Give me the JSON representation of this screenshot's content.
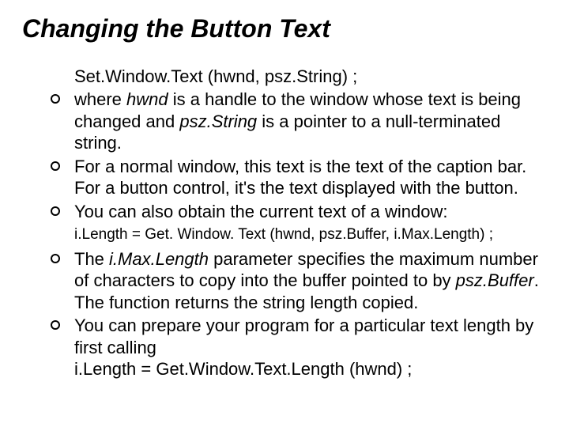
{
  "title": "Changing the Button Text",
  "codeLine": "Set.Window.Text (hwnd, psz.String) ;",
  "bullets": {
    "b1_pre": "where ",
    "b1_hwnd": "hwnd",
    "b1_mid": " is a handle to the window whose text is being changed and ",
    "b1_psz": "psz.String",
    "b1_post": " is a pointer to a null-terminated string.",
    "b2": "For a normal window, this text is the text of the caption bar. For a button control, it's the text displayed with the button.",
    "b3": "You can also obtain the current text of a window:",
    "subCode": "i.Length = Get. Window. Text (hwnd, psz.Buffer, i.Max.Length) ;",
    "b4_pre": "The ",
    "b4_imax": "i.Max.Length",
    "b4_mid": " parameter specifies the maximum number of characters to copy into the buffer pointed to by ",
    "b4_pszbuf": "psz.Buffer",
    "b4_post": ". The function returns the string length copied.",
    "b5_line1": "You can prepare your program for a particular text length by first calling",
    "b5_line2": "i.Length = Get.Window.Text.Length (hwnd) ;"
  }
}
